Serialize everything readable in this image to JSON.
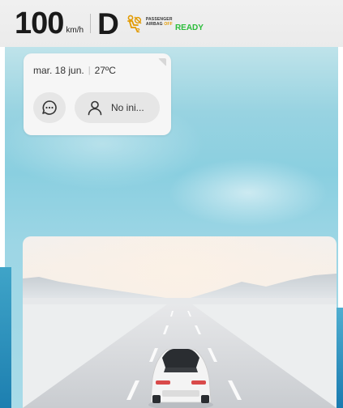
{
  "status_bar": {
    "speed": "100",
    "speed_unit": "km/h",
    "gear": "D",
    "airbag_line1": "PASSENGER",
    "airbag_line2": "AIRBAG",
    "airbag_state": "OFF",
    "ready": "READY",
    "colors": {
      "ready": "#2bbd3a",
      "airbag_icon": "#e29a00"
    }
  },
  "info_card": {
    "date": "mar. 18 jun.",
    "temperature": "27ºC",
    "chat_icon": "chat-bubble-icon",
    "user_icon": "user-icon",
    "user_label": "No ini..."
  },
  "road_scene": {
    "vehicle_icon": "car-icon"
  }
}
